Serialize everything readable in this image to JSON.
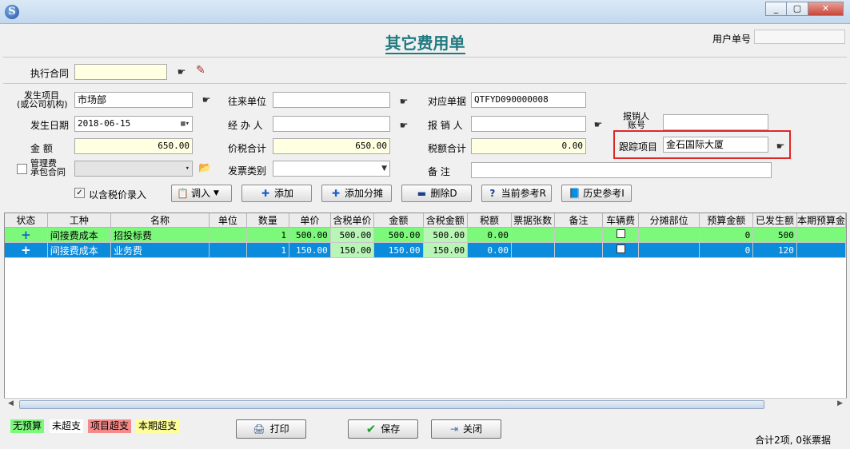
{
  "window": {
    "app_icon": "S",
    "minimize": "_",
    "maximize": "▢",
    "close": "✕"
  },
  "header": {
    "title": "其它费用单",
    "user_no_label": "用户单号",
    "user_no_value": ""
  },
  "contract": {
    "label": "执行合同",
    "value": ""
  },
  "form": {
    "project_label_1": "发生项目",
    "project_label_2": "(或公司机构)",
    "project_value": "市场部",
    "counterparty_label": "往来单位",
    "counterparty_value": "",
    "doc_label": "对应单据",
    "doc_value": "QTFYD090000008",
    "reimburser_acc_label_1": "报销人",
    "reimburser_acc_label_2": "账号",
    "reimburser_acc_value": "",
    "date_label": "发生日期",
    "date_value": "2018-06-15",
    "handler_label": "经 办 人",
    "handler_value": "",
    "reimburser_label": "报 销 人",
    "reimburser_value": "",
    "track_label": "跟踪项目",
    "track_value": "金石国际大厦",
    "amount_label": "金    额",
    "amount_value": "650.00",
    "total_label": "价税合计",
    "total_value": "650.00",
    "tax_label": "税额合计",
    "tax_value": "0.00",
    "mgmt_label_1": "管理费",
    "mgmt_label_2": "承包合同",
    "mgmt_value": "",
    "invoice_type_label": "发票类别",
    "invoice_type_value": "",
    "remark_label": "备    注",
    "remark_value": ""
  },
  "toolbar": {
    "tax_incl_label": "以含税价录入",
    "tax_incl_checked": "✓",
    "import_label": "调入",
    "add_label": "添加",
    "add_split_label": "添加分摊",
    "delete_label": "删除D",
    "current_ref_label": "当前参考R",
    "history_ref_label": "历史参考I"
  },
  "grid": {
    "columns": [
      "状态",
      "工种",
      "名称",
      "单位",
      "数量",
      "单价",
      "含税单价",
      "金额",
      "含税金额",
      "税额",
      "票据张数",
      "备注",
      "车辆费",
      "分摊部位",
      "预算金额",
      "已发生额",
      "本期预算金"
    ],
    "rows": [
      {
        "status": "+",
        "type": "间接费成本",
        "name": "招投标费",
        "unit": "",
        "qty": "1",
        "price": "500.00",
        "tax_price": "500.00",
        "amount": "500.00",
        "tax_amount": "500.00",
        "tax": "0.00",
        "bills": "",
        "remark": "",
        "vehicle": "",
        "split": "",
        "budget": "0",
        "occurred": "500",
        "period_budget": ""
      },
      {
        "status": "+",
        "type": "间接费成本",
        "name": "业务费",
        "unit": "",
        "qty": "1",
        "price": "150.00",
        "tax_price": "150.00",
        "amount": "150.00",
        "tax_amount": "150.00",
        "tax": "0.00",
        "bills": "",
        "remark": "",
        "vehicle": "",
        "split": "",
        "budget": "0",
        "occurred": "120",
        "period_budget": ""
      }
    ]
  },
  "legend": {
    "no_budget": "无预算",
    "not_over": "未超支",
    "project_over": "项目超支",
    "period_over": "本期超支",
    "colors": {
      "no_budget": "#7cf87a",
      "not_over": "#ffffff",
      "project_over": "#f48a8a",
      "period_over": "#ffff99"
    }
  },
  "buttons": {
    "print": "打印",
    "save": "保存",
    "close": "关闭"
  },
  "status_text": "合计2项, 0张票据"
}
